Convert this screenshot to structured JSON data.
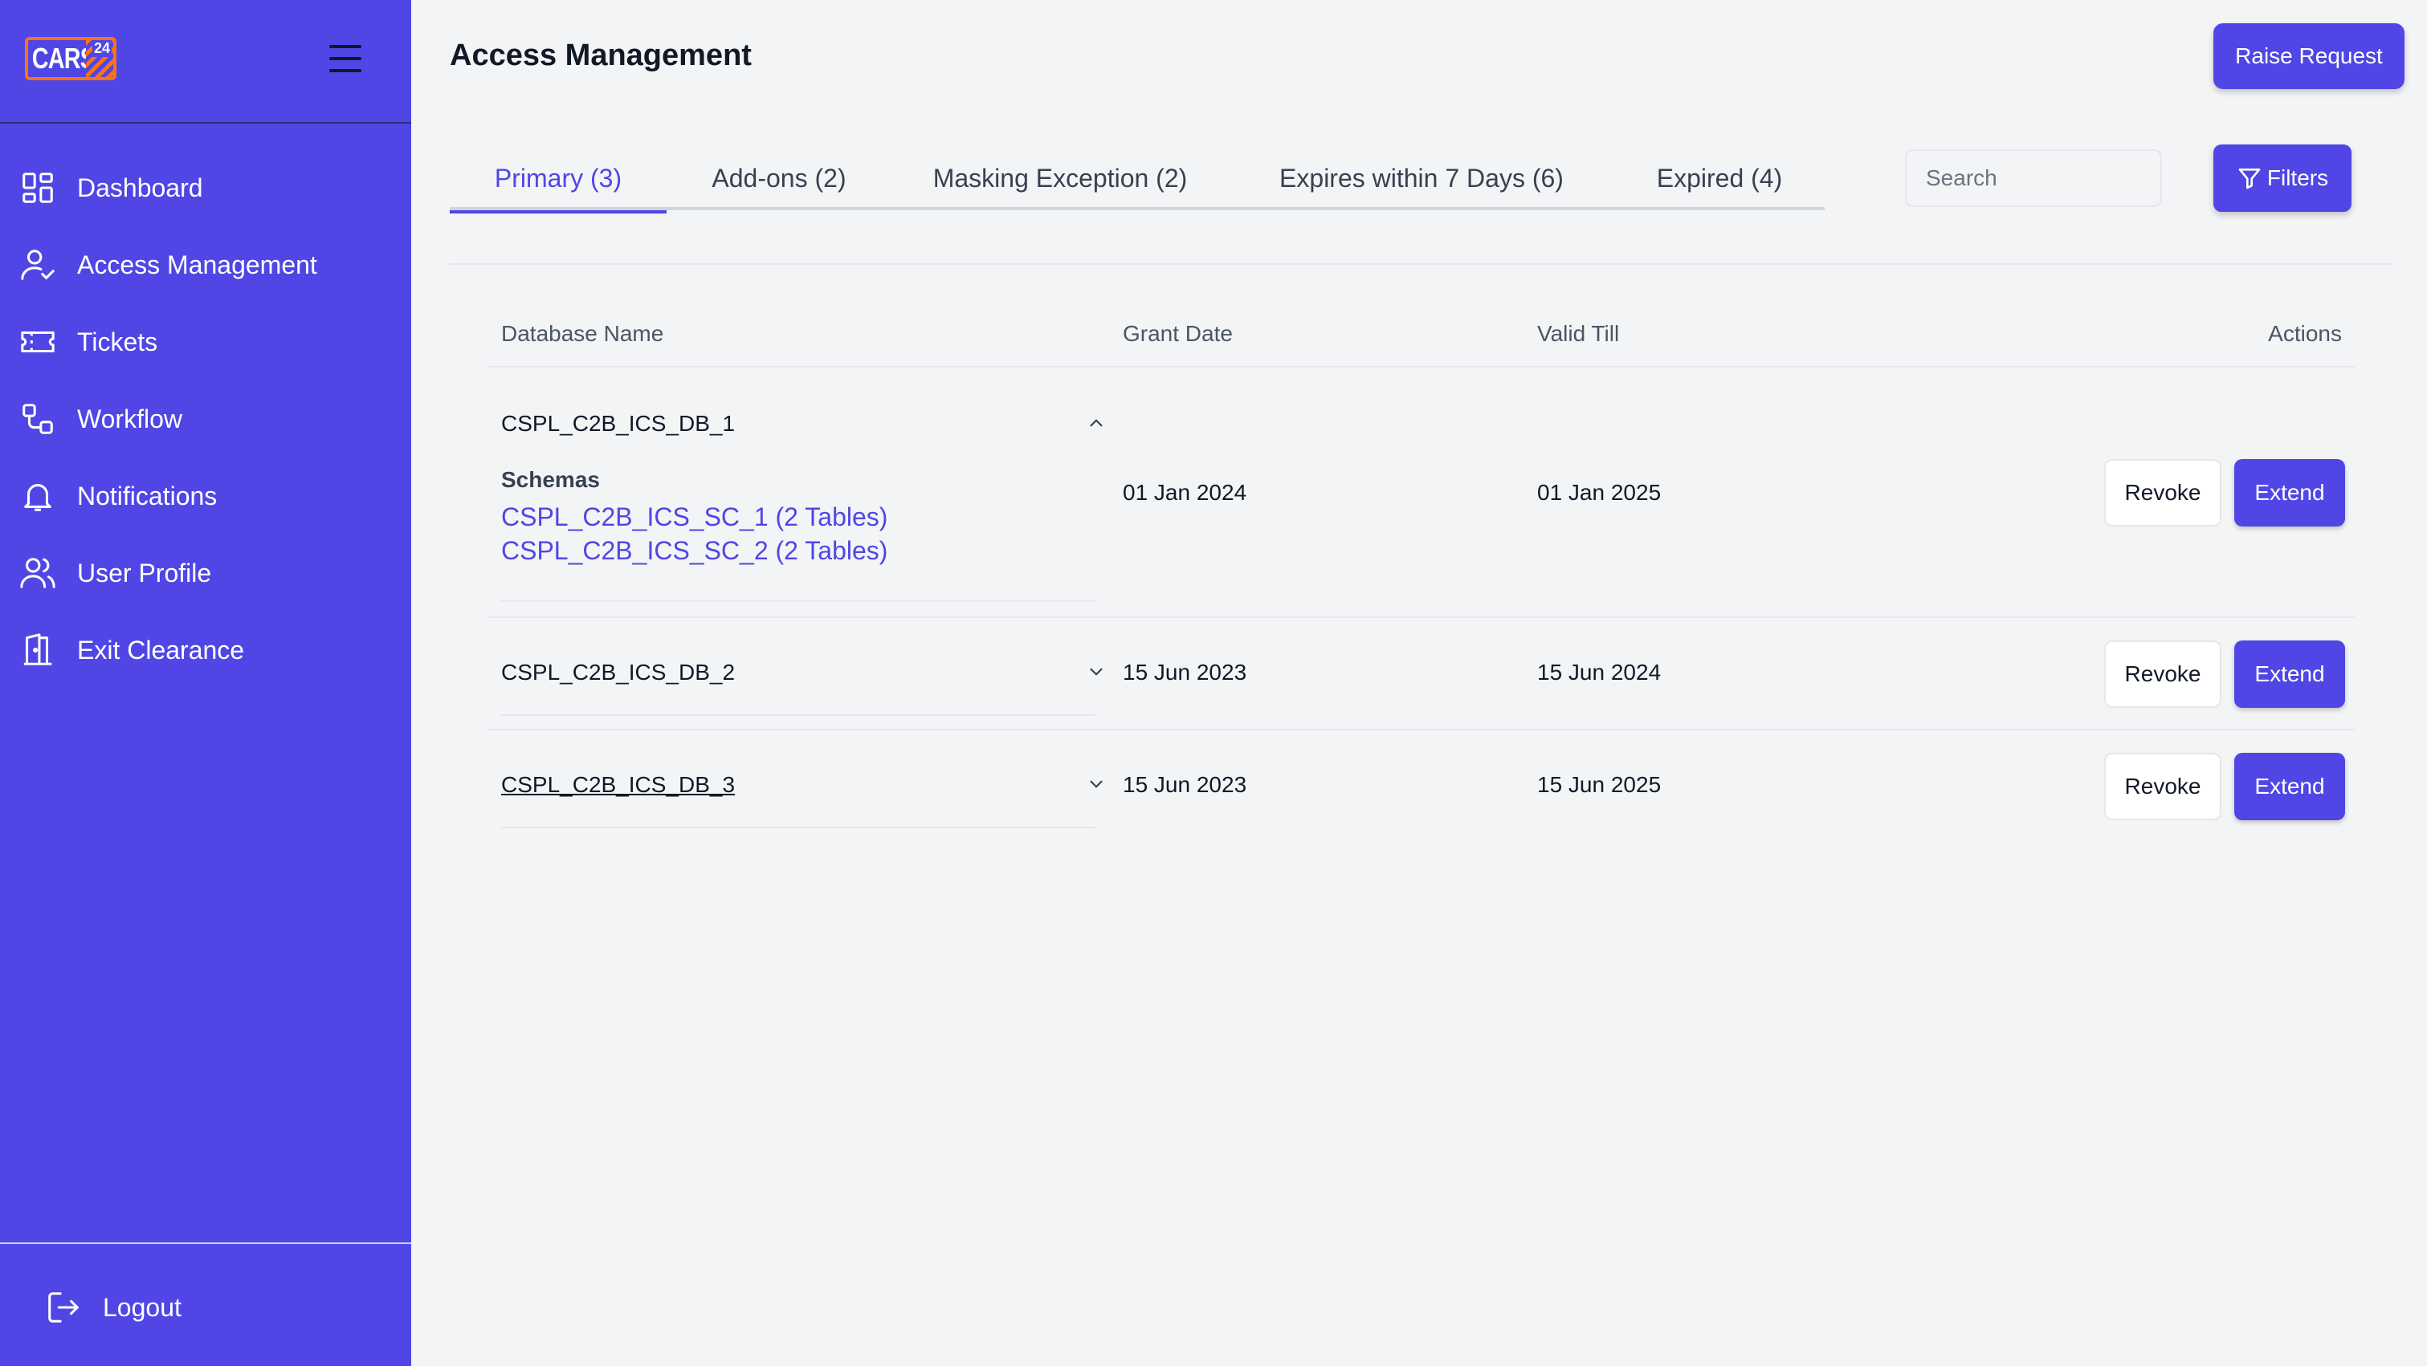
{
  "brand": {
    "logo_text": "CARS",
    "logo_badge": "24"
  },
  "sidebar": {
    "items": [
      {
        "label": "Dashboard",
        "icon": "dashboard-icon"
      },
      {
        "label": "Access Management",
        "icon": "user-check-icon"
      },
      {
        "label": "Tickets",
        "icon": "ticket-icon"
      },
      {
        "label": "Workflow",
        "icon": "workflow-icon"
      },
      {
        "label": "Notifications",
        "icon": "bell-icon"
      },
      {
        "label": "User Profile",
        "icon": "users-icon"
      },
      {
        "label": "Exit Clearance",
        "icon": "door-exit-icon"
      }
    ],
    "logout_label": "Logout"
  },
  "header": {
    "title": "Access Management",
    "raise_request_label": "Raise Request"
  },
  "tabs": [
    {
      "label": "Primary (3)",
      "active": true
    },
    {
      "label": "Add-ons (2)",
      "active": false
    },
    {
      "label": "Masking Exception (2)",
      "active": false
    },
    {
      "label": "Expires within 7 Days (6)",
      "active": false
    },
    {
      "label": "Expired (4)",
      "active": false
    }
  ],
  "search": {
    "placeholder": "Search",
    "value": ""
  },
  "filters_label": "Filters",
  "table": {
    "columns": [
      "Database Name",
      "Grant Date",
      "Valid Till",
      "Actions"
    ],
    "schemas_label": "Schemas",
    "revoke_label": "Revoke",
    "extend_label": "Extend",
    "rows": [
      {
        "database": "CSPL_C2B_ICS_DB_1",
        "grant_date": "01 Jan 2024",
        "valid_till": "01 Jan 2025",
        "expanded": true,
        "schemas": [
          "CSPL_C2B_ICS_SC_1 (2 Tables)",
          "CSPL_C2B_ICS_SC_2 (2 Tables)"
        ]
      },
      {
        "database": "CSPL_C2B_ICS_DB_2",
        "grant_date": "15 Jun 2023",
        "valid_till": "15 Jun 2024",
        "expanded": false
      },
      {
        "database": "CSPL_C2B_ICS_DB_3",
        "grant_date": "15 Jun 2023",
        "valid_till": "15 Jun 2025",
        "expanded": false
      }
    ]
  },
  "colors": {
    "accent": "#4f46e5",
    "sidebar_bg": "#4f46e5",
    "page_bg": "#f3f4f6",
    "logo_orange": "#f97316"
  }
}
